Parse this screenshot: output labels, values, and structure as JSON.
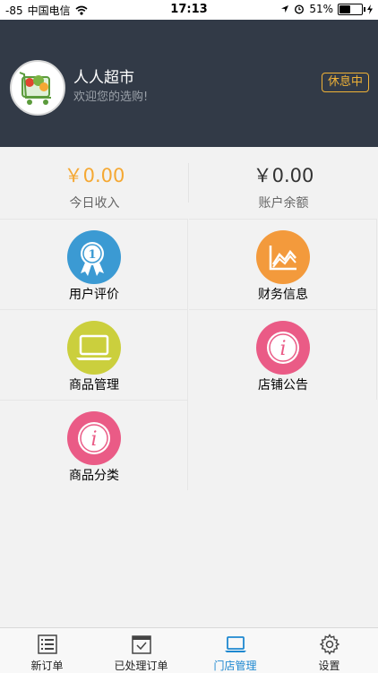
{
  "statusbar": {
    "signal": "-85",
    "carrier": "中国电信",
    "time": "17:13",
    "battery_percent": "51%",
    "battery_level": 0.51
  },
  "header": {
    "store_name": "人人超市",
    "welcome": "欢迎您的选购!",
    "status": "休息中",
    "status_color": "#f0b237",
    "background_color": "#323a47"
  },
  "stats": {
    "income_amount": "￥0.00",
    "income_label": "今日收入",
    "income_color": "#f5a833",
    "balance_amount": "￥0.00",
    "balance_label": "账户余额",
    "balance_color": "#333333"
  },
  "menu": [
    {
      "label": "用户评价",
      "icon": "award-ribbon-icon",
      "color": "#3b9ad3"
    },
    {
      "label": "财务信息",
      "icon": "line-chart-icon",
      "color": "#f39a3c"
    },
    {
      "label": "商品管理",
      "icon": "laptop-icon",
      "color": "#cbcf3d"
    },
    {
      "label": "店铺公告",
      "icon": "info-icon",
      "color": "#ea5b86"
    },
    {
      "label": "商品分类",
      "icon": "info-icon",
      "color": "#ea5b86"
    }
  ],
  "tabbar": {
    "tabs": [
      {
        "label": "新订单",
        "icon": "list-icon"
      },
      {
        "label": "已处理订单",
        "icon": "checked-calendar-icon"
      },
      {
        "label": "门店管理",
        "icon": "laptop-icon"
      },
      {
        "label": "设置",
        "icon": "gear-icon"
      }
    ],
    "active_index": 2,
    "active_color": "#1e88d0"
  }
}
